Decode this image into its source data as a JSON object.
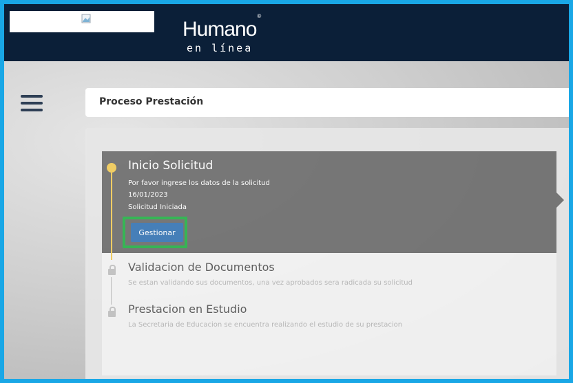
{
  "header": {
    "brand": "Humano",
    "registered": "®",
    "subtitle": "en línea"
  },
  "page": {
    "title": "Proceso Prestación"
  },
  "steps": [
    {
      "title": "Inicio Solicitud",
      "lines": [
        "Por favor ingrese los datos de la solicitud",
        "16/01/2023",
        "Solicitud Iniciada"
      ],
      "action": "Gestionar",
      "status": "active"
    },
    {
      "title": "Validacion de Documentos",
      "description": "Se estan validando sus documentos, una vez aprobados sera radicada su solicitud",
      "status": "locked"
    },
    {
      "title": "Prestacion en Estudio",
      "description": "La Secretaria de Educacion se encuentra realizando el estudio de su prestacion",
      "status": "locked"
    }
  ],
  "colors": {
    "frame": "#19a7e6",
    "header": "#0b1f38",
    "active_step": "#6f6f6f",
    "active_dot": "#f2cc5a",
    "button": "#3a78b6",
    "highlight": "#29b34a"
  },
  "icons": [
    "menu-icon",
    "broken-image-icon",
    "lock-icon"
  ]
}
